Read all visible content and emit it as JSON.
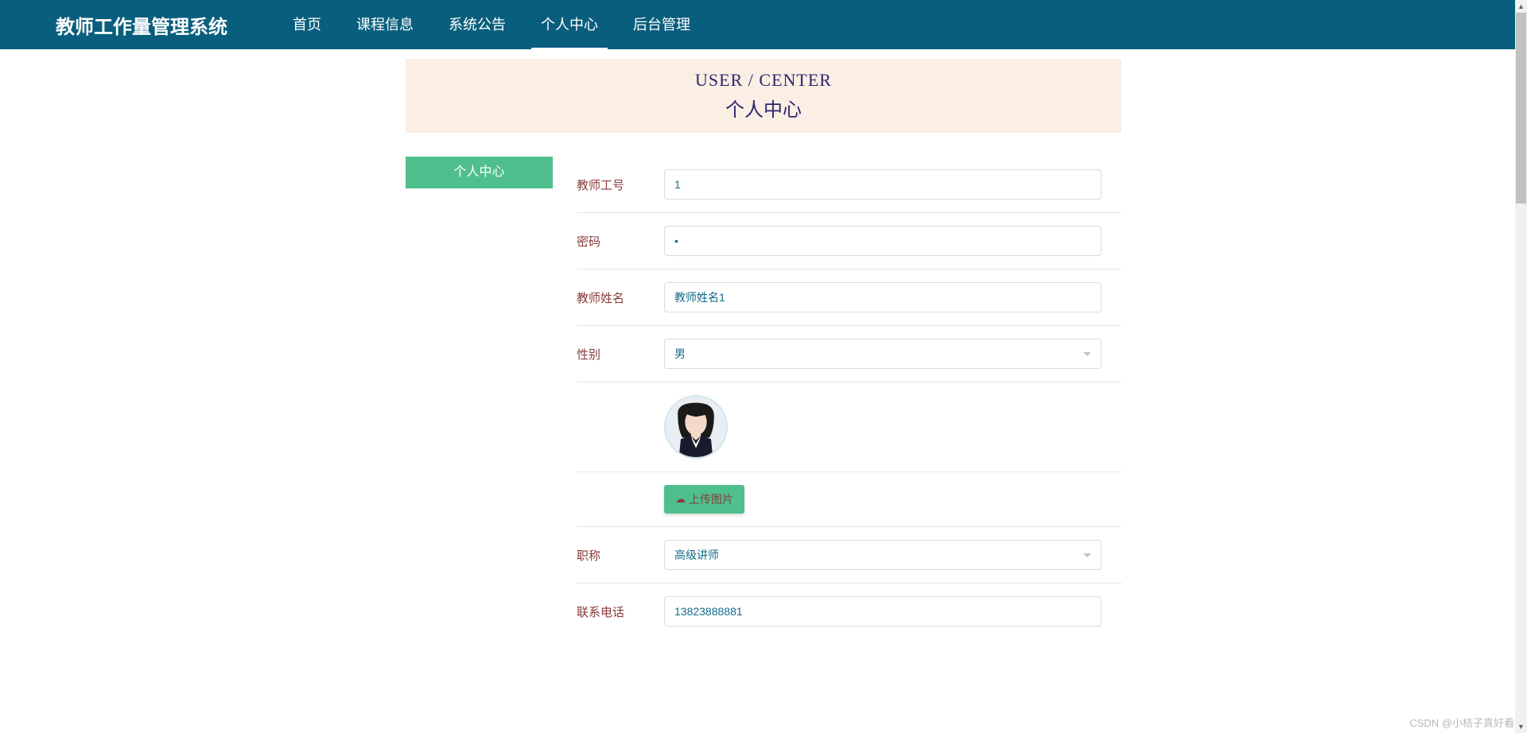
{
  "header": {
    "logo": "教师工作量管理系统",
    "nav": [
      "首页",
      "课程信息",
      "系统公告",
      "个人中心",
      "后台管理"
    ],
    "active_index": 3
  },
  "banner": {
    "title_en": "USER / CENTER",
    "title_cn": "个人中心"
  },
  "sidebar": {
    "tab": "个人中心"
  },
  "form": {
    "teacher_id": {
      "label": "教师工号",
      "value": "1"
    },
    "password": {
      "label": "密码",
      "value": "1"
    },
    "teacher_name": {
      "label": "教师姓名",
      "value": "教师姓名1"
    },
    "gender": {
      "label": "性别",
      "value": "男"
    },
    "upload": {
      "label": "上传图片"
    },
    "title": {
      "label": "职称",
      "value": "高级讲师"
    },
    "phone": {
      "label": "联系电话",
      "value": "13823888881"
    }
  },
  "watermark": "CSDN @小桔子真好看"
}
